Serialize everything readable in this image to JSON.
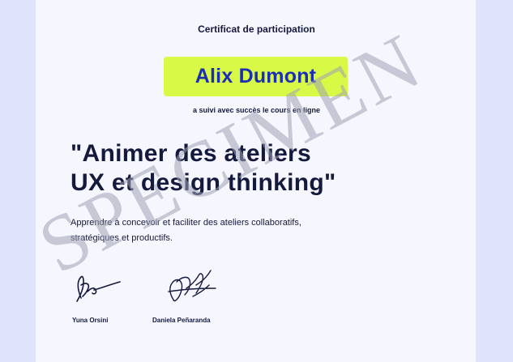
{
  "certificate": {
    "header": "Certificat de participation",
    "recipient_name": "Alix Dumont",
    "subline": "a suivi avec succès le cours en ligne",
    "course_title_line1": "\"Animer des ateliers",
    "course_title_line2": "UX et design thinking\"",
    "description_line1": "Apprendre à concevoir et faciliter des ateliers collaboratifs,",
    "description_line2": "stratégiques et productifs."
  },
  "signatories": [
    {
      "name": "Yuna Orsini"
    },
    {
      "name": "Daniela Peñaranda"
    }
  ],
  "watermark": {
    "text": "SPECIMEN"
  },
  "colors": {
    "name_highlight": "#d9f947",
    "name_text": "#1b2fb2",
    "text_dark": "#141a3d",
    "watermark": "#b8bbc8"
  }
}
